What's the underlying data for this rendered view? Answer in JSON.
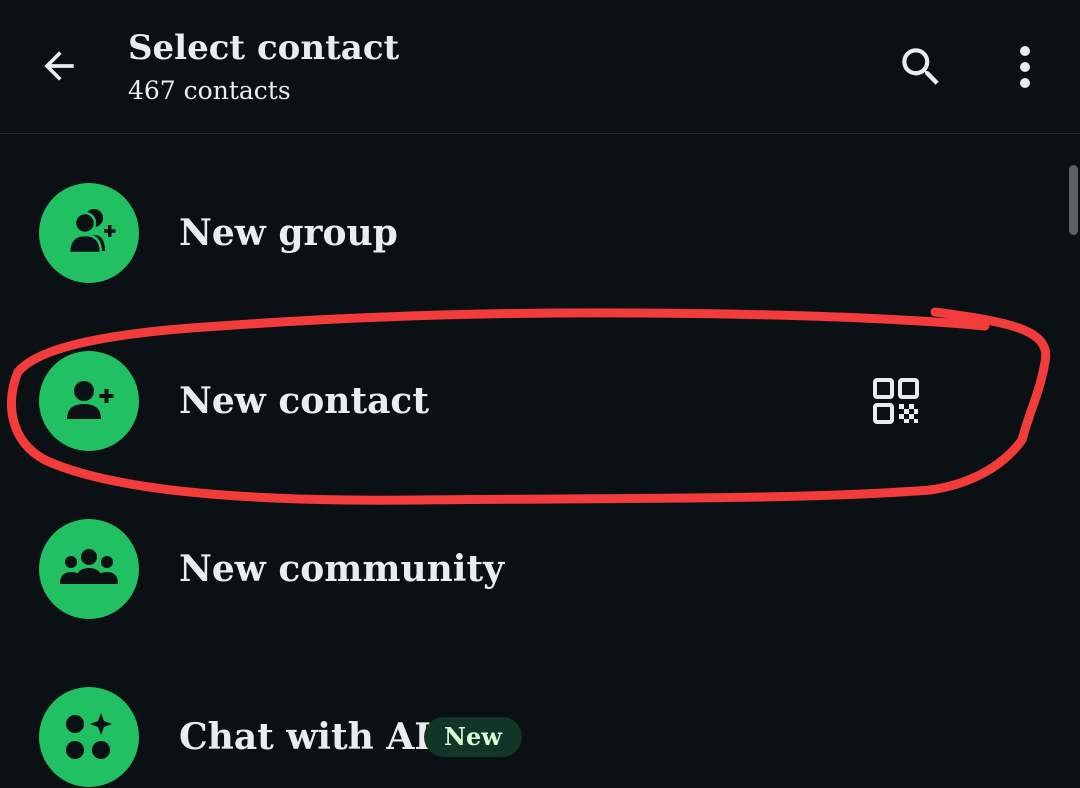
{
  "header": {
    "title": "Select contact",
    "subtitle": "467 contacts"
  },
  "items": [
    {
      "label": "New group",
      "icon": "group-add-icon"
    },
    {
      "label": "New contact",
      "icon": "person-add-icon",
      "trailing_icon": "qr-code-icon"
    },
    {
      "label": "New community",
      "icon": "community-icon"
    },
    {
      "label": "Chat with AIs",
      "icon": "ai-chat-icon",
      "badge": "New"
    }
  ],
  "colors": {
    "background": "#0b1014",
    "accent_green": "#21c063",
    "text": "#e9edef",
    "badge_bg": "#103529",
    "annotation_red": "#f23b3b"
  }
}
